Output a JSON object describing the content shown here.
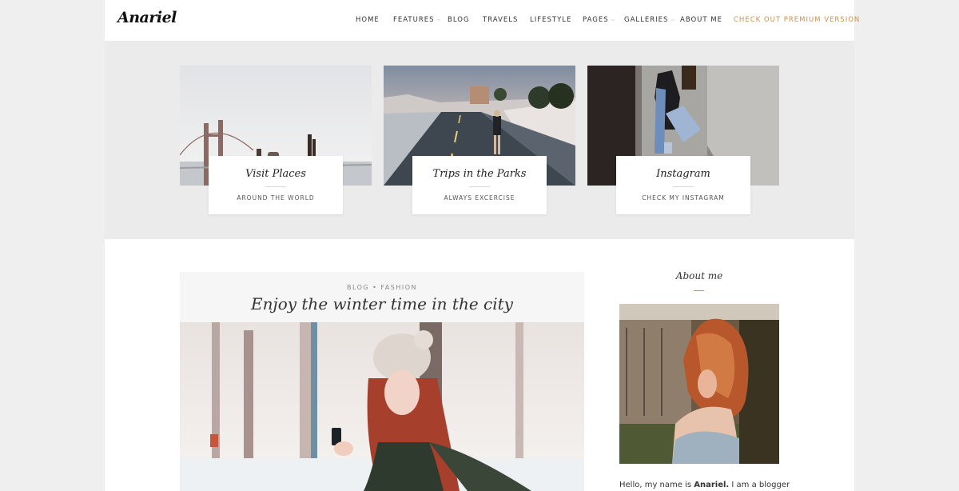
{
  "site": {
    "logo": "Anariel"
  },
  "nav": {
    "items": [
      {
        "label": "HOME"
      },
      {
        "label": "FEATURES"
      },
      {
        "label": "BLOG"
      },
      {
        "label": "TRAVELS"
      },
      {
        "label": "LIFESTYLE"
      },
      {
        "label": "PAGES"
      },
      {
        "label": "GALLERIES"
      },
      {
        "label": "ABOUT ME"
      },
      {
        "label": "CHECK OUT PREMIUM VERSION"
      }
    ],
    "caret_icon": "chevron-down-icon"
  },
  "features": [
    {
      "title": "Visit Places",
      "subtitle": "AROUND THE WORLD"
    },
    {
      "title": "Trips in the Parks",
      "subtitle": "ALWAYS EXCERCISE"
    },
    {
      "title": "Instagram",
      "subtitle": "CHECK MY INSTAGRAM"
    }
  ],
  "post": {
    "categories": "BLOG • FASHION",
    "title": "Enjoy the winter time in the city"
  },
  "sidebar": {
    "widget_title": "About me",
    "intro_prefix": "Hello, my name is ",
    "intro_name": "Anariel.",
    "intro_suffix": " I am a blogger"
  },
  "colors": {
    "accent": "#c9914f",
    "page_bg": "#efefef",
    "featured_bg": "#ebebeb"
  }
}
